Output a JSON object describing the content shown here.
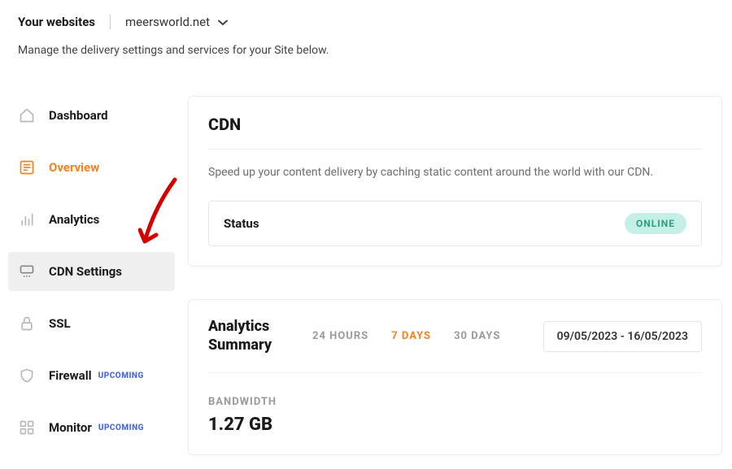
{
  "header": {
    "label": "Your websites",
    "site": "meersworld.net",
    "subtitle": "Manage the delivery settings and services for your Site below."
  },
  "sidebar": {
    "items": [
      {
        "label": "Dashboard"
      },
      {
        "label": "Overview"
      },
      {
        "label": "Analytics"
      },
      {
        "label": "CDN Settings"
      },
      {
        "label": "SSL"
      },
      {
        "label": "Firewall",
        "badge": "UPCOMING"
      },
      {
        "label": "Monitor",
        "badge": "UPCOMING"
      }
    ]
  },
  "cdn": {
    "title": "CDN",
    "desc": "Speed up your content delivery by caching static content around the world with our CDN.",
    "status_label": "Status",
    "status_value": "ONLINE"
  },
  "analytics": {
    "title": "Analytics Summary",
    "ranges": [
      "24 HOURS",
      "7 DAYS",
      "30 DAYS"
    ],
    "date_range": "09/05/2023 - 16/05/2023",
    "bandwidth_label": "BANDWIDTH",
    "bandwidth_value": "1.27 GB"
  }
}
